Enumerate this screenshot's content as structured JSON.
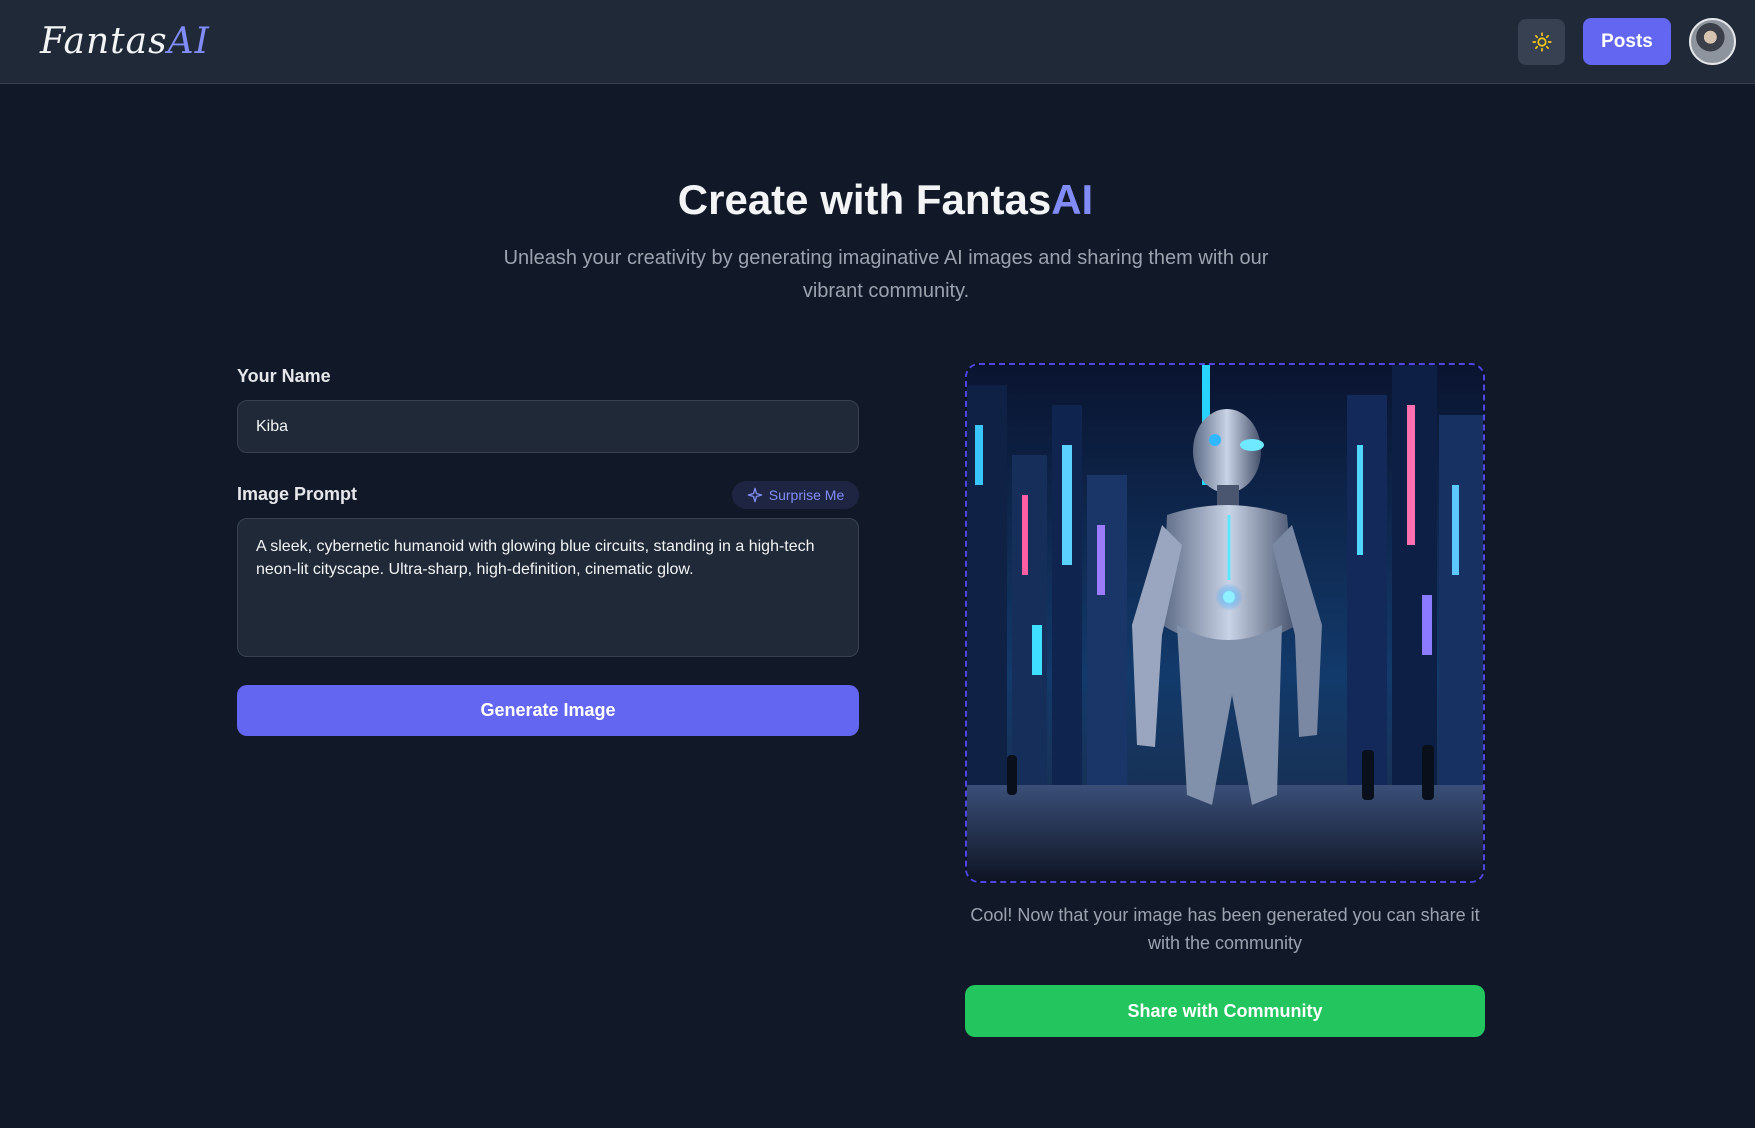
{
  "header": {
    "logo_part1": "Fantas",
    "logo_part2": "AI",
    "theme_icon": "sun-icon",
    "posts_label": "Posts",
    "avatar_icon": "user-avatar"
  },
  "hero": {
    "title_part1": "Create with Fantas",
    "title_part2": "AI",
    "subtitle": "Unleash your creativity by generating imaginative AI images and sharing them with our vibrant community."
  },
  "form": {
    "name_label": "Your Name",
    "name_value": "Kiba",
    "prompt_label": "Image Prompt",
    "surprise_label": "Surprise Me",
    "surprise_icon": "sparkle-icon",
    "prompt_value": "A sleek, cybernetic humanoid with glowing blue circuits, standing in a high-tech neon-lit cityscape. Ultra-sharp, high-definition, cinematic glow.",
    "generate_label": "Generate Image"
  },
  "preview": {
    "caption": "Cool! Now that your image has been generated you can share it with the community",
    "share_label": "Share with Community"
  },
  "colors": {
    "background": "#111827",
    "header": "#1f2937",
    "accent": "#6366f1",
    "accent_text": "#818cf8",
    "share": "#22c55e"
  }
}
